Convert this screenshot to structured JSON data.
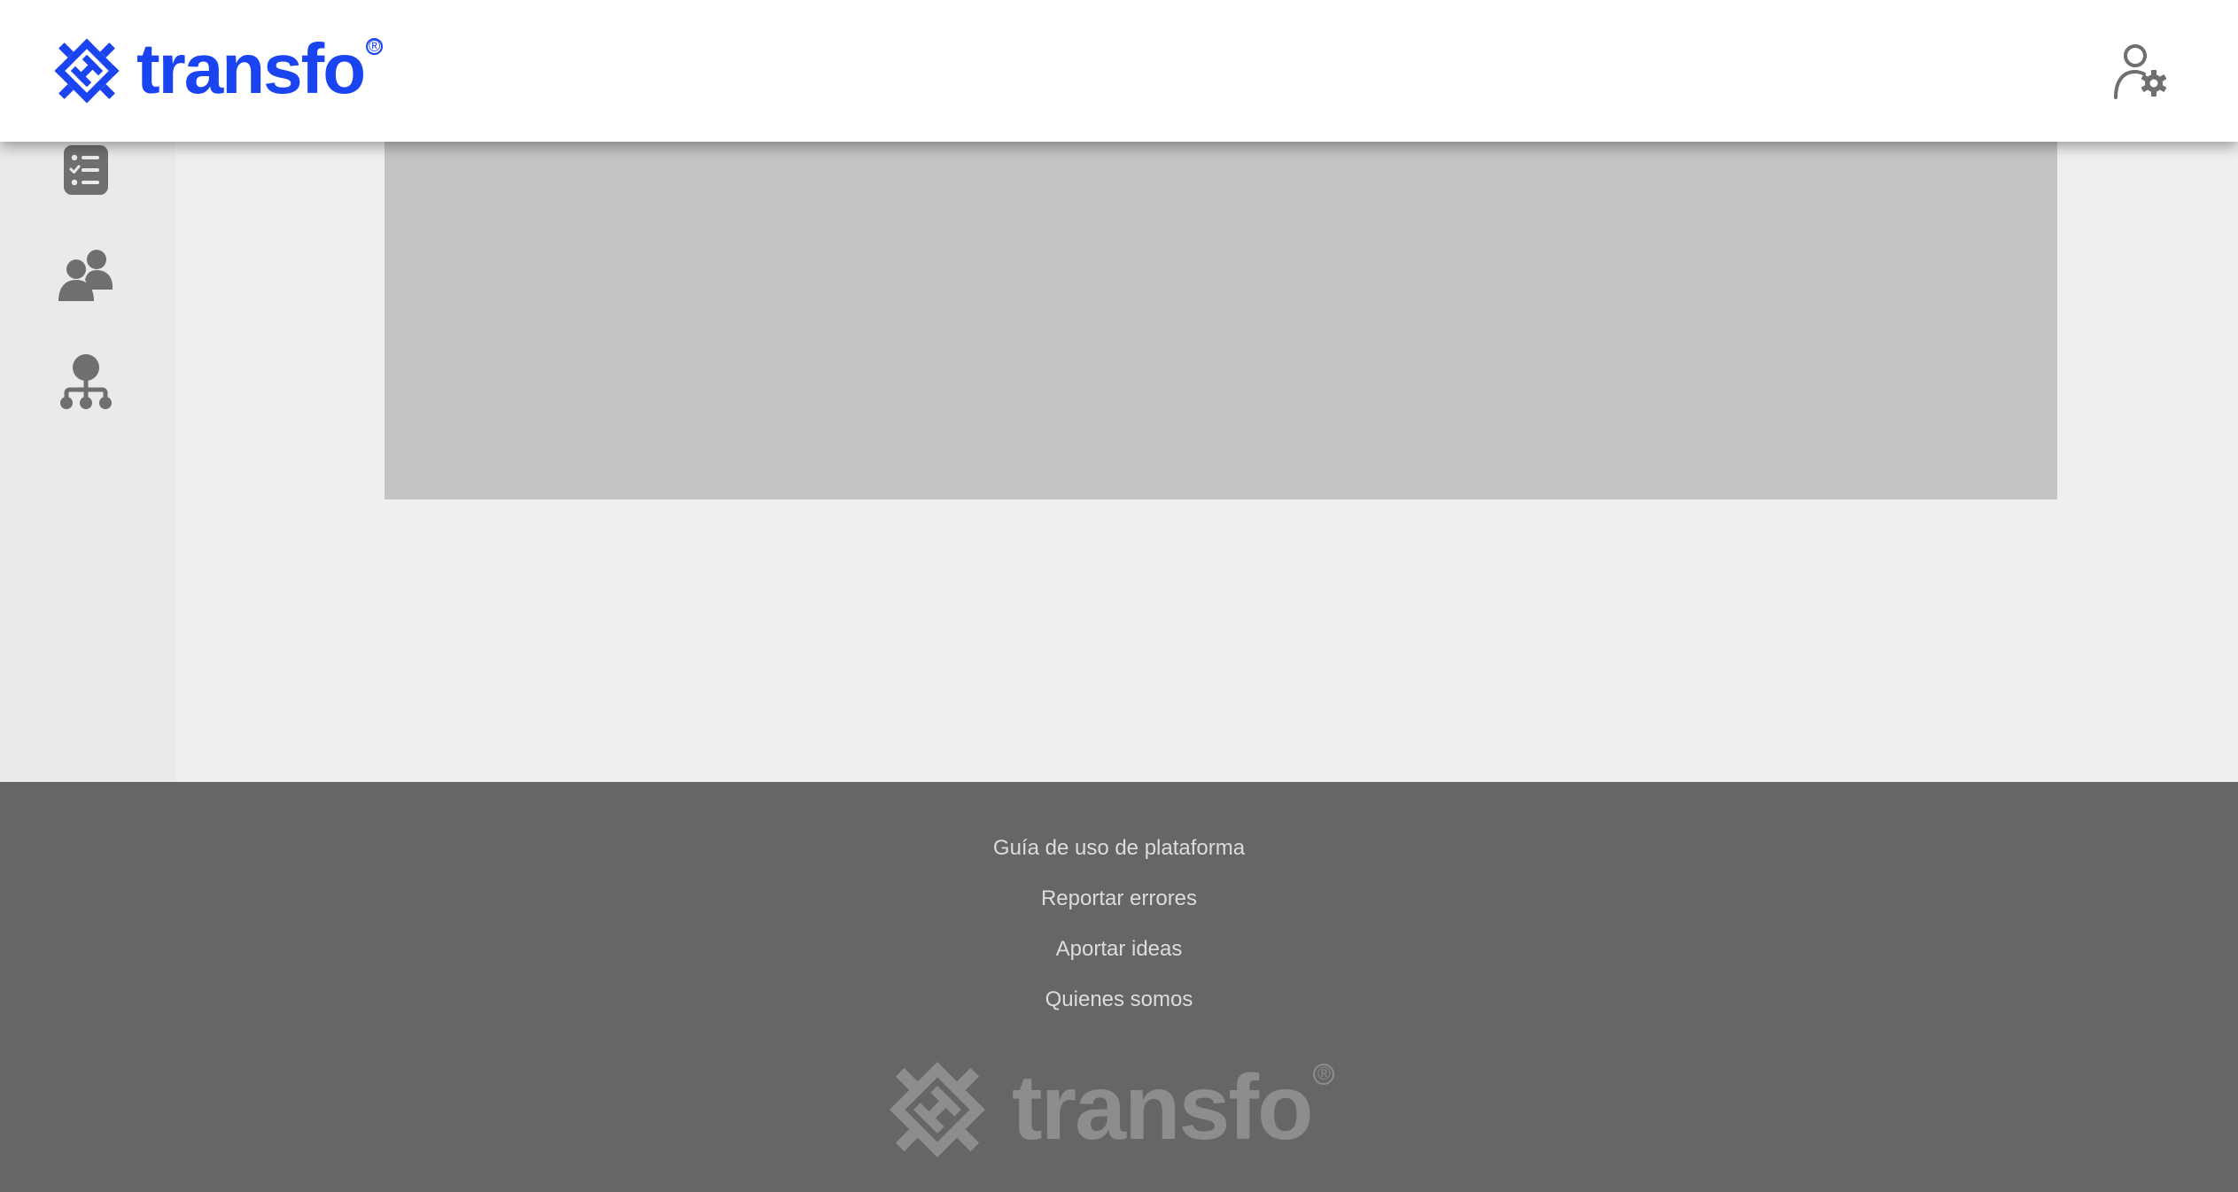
{
  "brand": {
    "name": "transfo",
    "registered": "®",
    "primary_color": "#1a44f0",
    "footer_logo_color": "#8d8d8d"
  },
  "header": {
    "user_settings_icon": "user-gear-icon"
  },
  "sidebar": {
    "items": [
      {
        "name": "checklist",
        "icon": "checklist-icon"
      },
      {
        "name": "users",
        "icon": "users-icon"
      },
      {
        "name": "organization",
        "icon": "org-chart-icon"
      }
    ]
  },
  "footer": {
    "links": [
      "Guía de uso de plataforma",
      "Reportar errores",
      "Aportar ideas",
      "Quienes somos"
    ]
  }
}
